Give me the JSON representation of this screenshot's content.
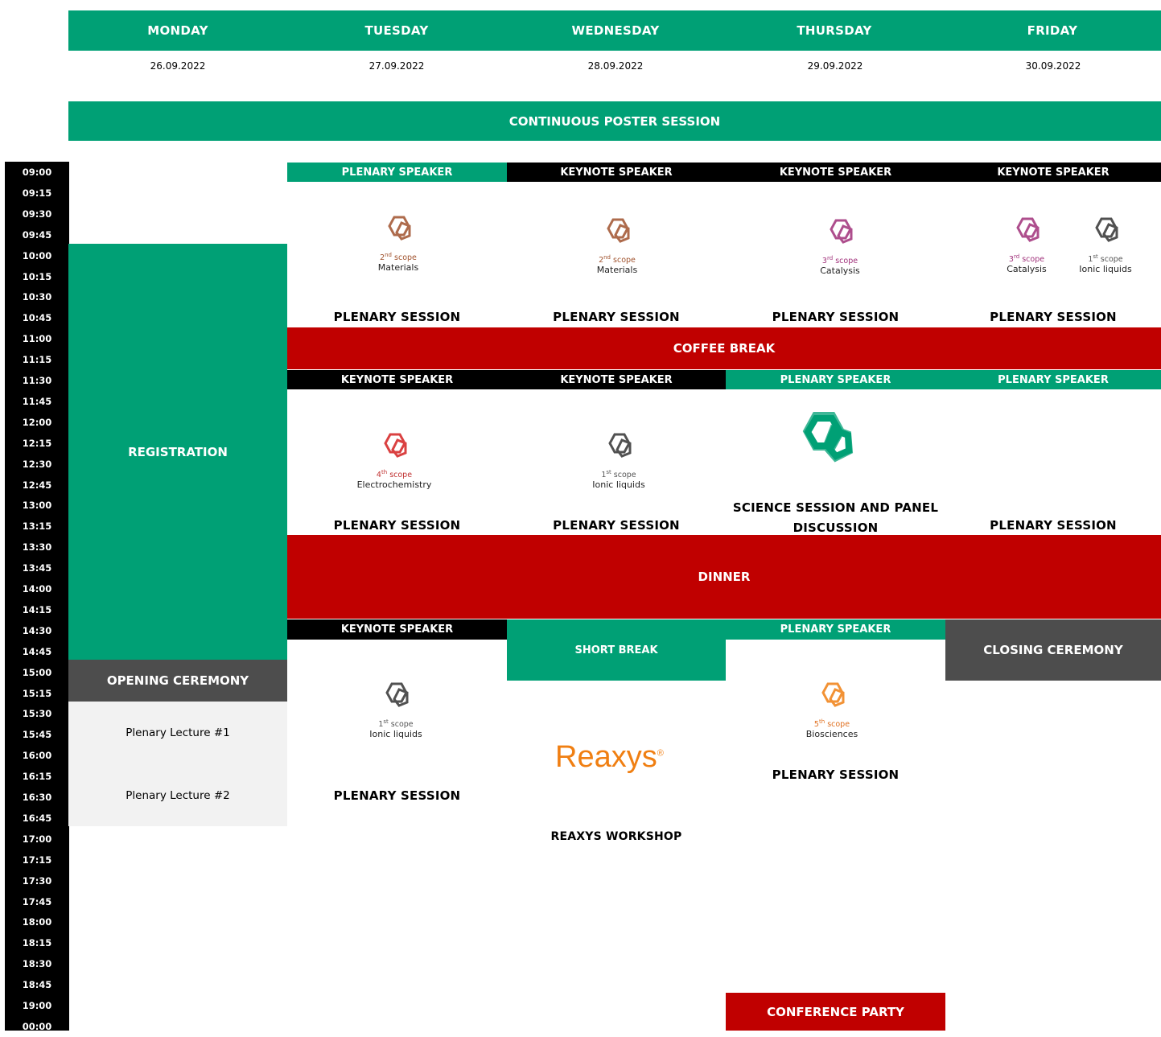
{
  "days": [
    {
      "name": "MONDAY",
      "date": "26.09.2022"
    },
    {
      "name": "TUESDAY",
      "date": "27.09.2022"
    },
    {
      "name": "WEDNESDAY",
      "date": "28.09.2022"
    },
    {
      "name": "THURSDAY",
      "date": "29.09.2022"
    },
    {
      "name": "FRIDAY",
      "date": "30.09.2022"
    }
  ],
  "poster_session": "CONTINUOUS POSTER SESSION",
  "times": [
    "09:00",
    "09:15",
    "09:30",
    "09:45",
    "10:00",
    "10:15",
    "10:30",
    "10:45",
    "11:00",
    "11:15",
    "11:30",
    "11:45",
    "12:00",
    "12:15",
    "12:30",
    "12:45",
    "13:00",
    "13:15",
    "13:30",
    "13:45",
    "14:00",
    "14:15",
    "14:30",
    "14:45",
    "15:00",
    "15:15",
    "15:30",
    "15:45",
    "16:00",
    "16:15",
    "16:30",
    "16:45",
    "17:00",
    "17:15",
    "17:30",
    "17:45",
    "18:00",
    "18:15",
    "18:30",
    "18:45",
    "19:00",
    "00:00"
  ],
  "labels": {
    "plenary_speaker": "PLENARY SPEAKER",
    "keynote_speaker": "KEYNOTE SPEAKER",
    "plenary_session": "PLENARY SESSION",
    "coffee_break": "COFFEE BREAK",
    "dinner": "DINNER",
    "registration": "REGISTRATION",
    "opening_ceremony": "OPENING CEREMONY",
    "plenary_lecture_1": "Plenary Lecture #1",
    "plenary_lecture_2": "Plenary Lecture #2",
    "short_break": "SHORT BREAK",
    "closing_ceremony": "CLOSING CEREMONY",
    "science_session": "SCIENCE SESSION AND PANEL DISCUSSION",
    "reaxys_workshop": "REAXYS WORKSHOP",
    "reaxys_logo": "Reaxys",
    "conference_party": "CONFERENCE PARTY"
  },
  "scopes": {
    "materials": {
      "num": "2",
      "sup": "nd",
      "word": "scope",
      "topic": "Materials",
      "color": "#a0522d"
    },
    "catalysis": {
      "num": "3",
      "sup": "rd",
      "word": "scope",
      "topic": "Catalysis",
      "color": "#a0307a"
    },
    "ionic": {
      "num": "1",
      "sup": "st",
      "word": "scope",
      "topic": "Ionic liquids",
      "color": "#333333"
    },
    "electro": {
      "num": "4",
      "sup": "th",
      "word": "scope",
      "topic": "Electrochemistry",
      "color": "#d42020"
    },
    "bio": {
      "num": "5",
      "sup": "th",
      "word": "scope",
      "topic": "Biosciences",
      "color": "#f07f12"
    }
  },
  "colors": {
    "green": "#00a075",
    "red": "#c00000",
    "black": "#000000",
    "grey": "#4d4d4d",
    "reaxys": "#f07f12"
  }
}
